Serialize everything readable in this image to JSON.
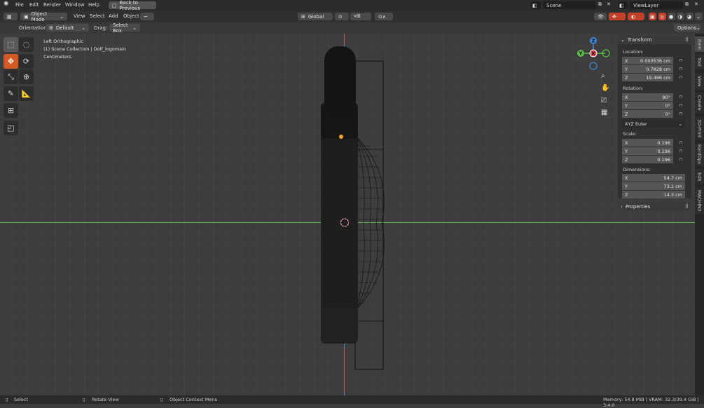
{
  "topbar": {
    "menus": [
      "File",
      "Edit",
      "Render",
      "Window",
      "Help"
    ],
    "back_label": "Back to Previous",
    "scene": "Scene",
    "view_layer": "ViewLayer"
  },
  "header": {
    "mode": "Object Mode",
    "menus": [
      "View",
      "Select",
      "Add",
      "Object"
    ],
    "transform_orientation": "Global"
  },
  "tool_settings": {
    "orientation_label": "Orientation:",
    "orientation_value": "Default",
    "drag_label": "Drag:",
    "drag_value": "Select Box",
    "options": "Options"
  },
  "viewport": {
    "view_name": "Left Orthographic",
    "collection": "(1) Scene Collection | Dolf_logomain",
    "units": "Centimeters",
    "gizmo_axes": [
      "X",
      "Y",
      "Z"
    ]
  },
  "npanel": {
    "transform_title": "Transform",
    "location_label": "Location:",
    "location": [
      {
        "axis": "X",
        "value": "0.000536 cm"
      },
      {
        "axis": "Y",
        "value": "0.7828 cm"
      },
      {
        "axis": "Z",
        "value": "19.486 cm"
      }
    ],
    "rotation_label": "Rotation:",
    "rotation": [
      {
        "axis": "X",
        "value": "90°"
      },
      {
        "axis": "Y",
        "value": "0°"
      },
      {
        "axis": "Z",
        "value": "0°"
      }
    ],
    "rotation_mode": "XYZ Euler",
    "scale_label": "Scale:",
    "scale": [
      {
        "axis": "X",
        "value": "0.196"
      },
      {
        "axis": "Y",
        "value": "0.196"
      },
      {
        "axis": "Z",
        "value": "0.196"
      }
    ],
    "dimensions_label": "Dimensions:",
    "dimensions": [
      {
        "axis": "X",
        "value": "54.7 cm"
      },
      {
        "axis": "Y",
        "value": "73.1 cm"
      },
      {
        "axis": "Z",
        "value": "14.3 cm"
      }
    ],
    "properties_title": "Properties"
  },
  "side_tabs": [
    "Item",
    "Tool",
    "View",
    "Create",
    "3D-Print",
    "HardOps",
    "Edit",
    "MACHIN3"
  ],
  "statusbar": {
    "select": "Select",
    "rotate": "Rotate View",
    "context": "Object Context Menu",
    "memory": "Memory: 54.8 MiB | VRAM: 32.3/39.4 GiB | 3.4.0"
  },
  "colors": {
    "accent": "#d35a26",
    "x_axis": "#e64459",
    "y_axis": "#5dbd4b",
    "z_axis": "#3f86d6",
    "selected_origin": "#ffa42b"
  }
}
